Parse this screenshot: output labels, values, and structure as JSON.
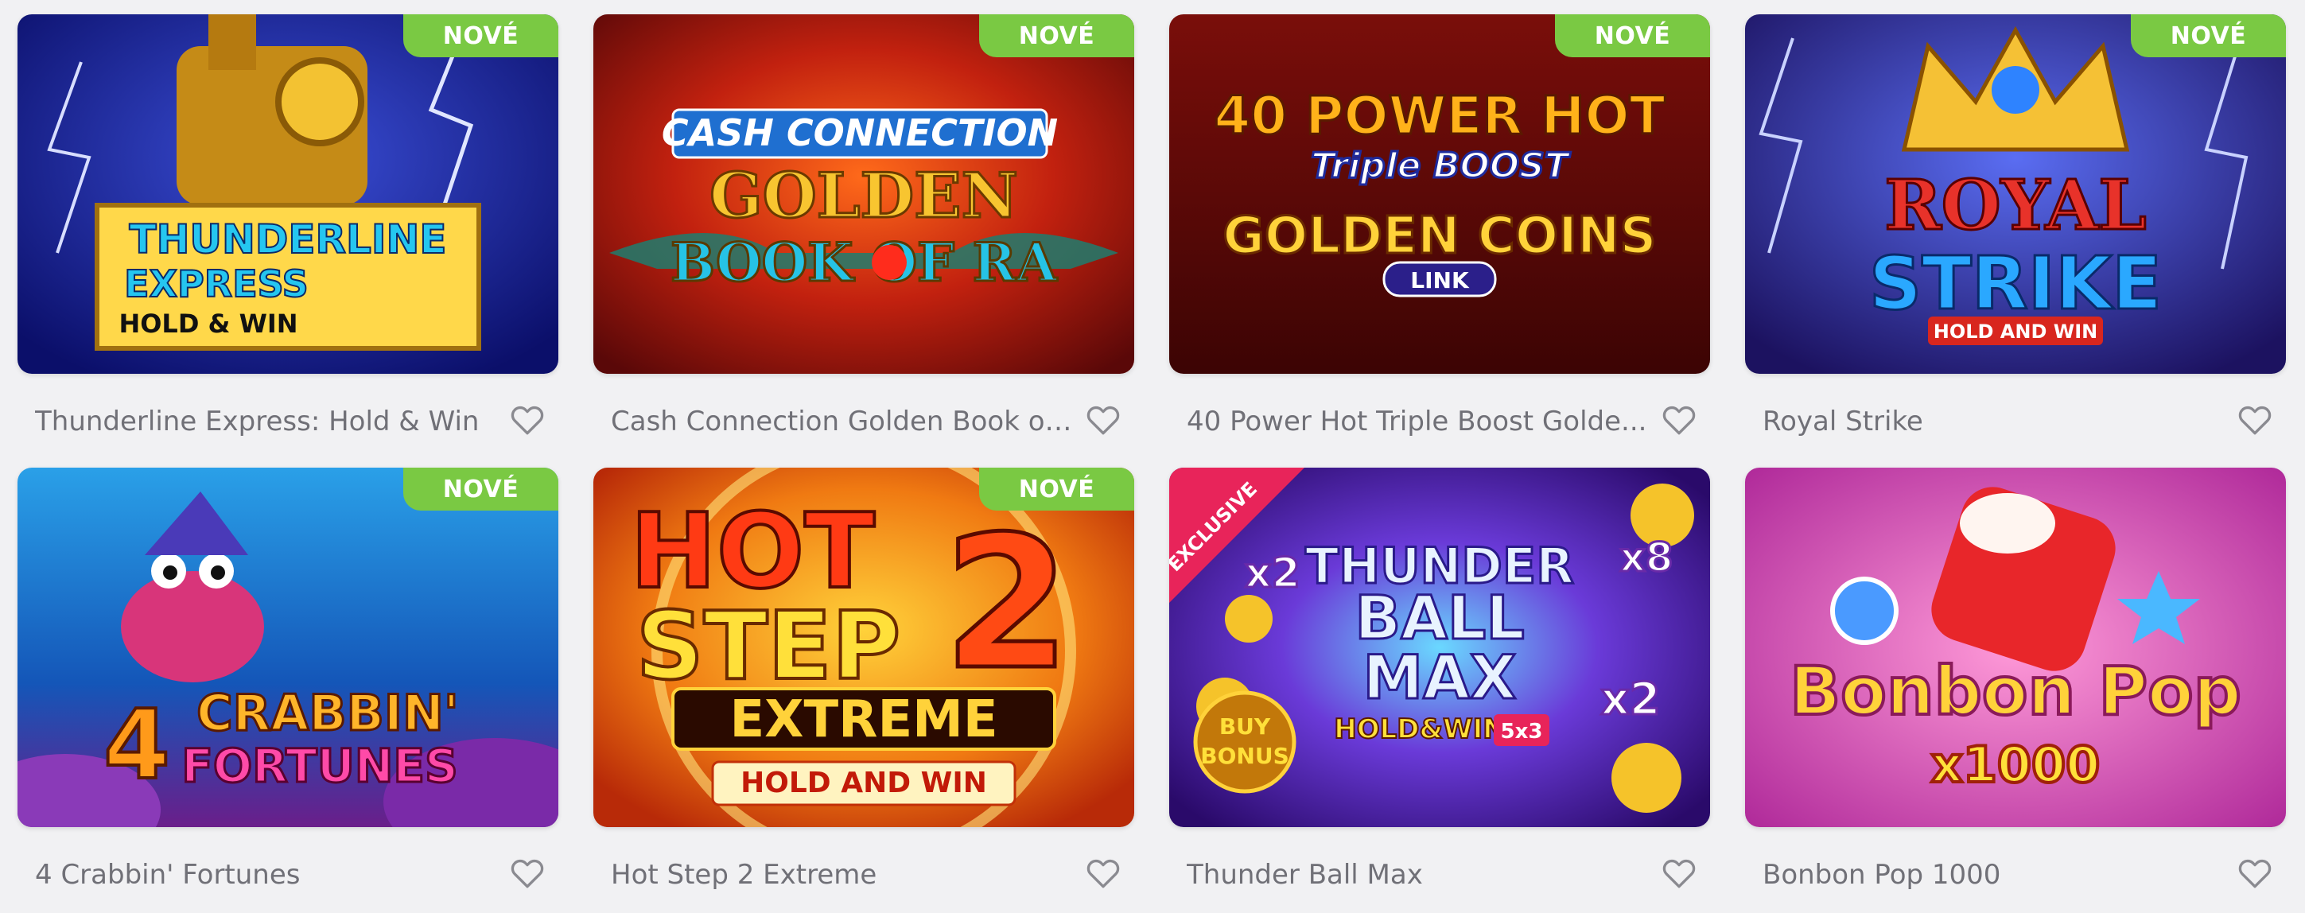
{
  "badge_label": "NOVÉ",
  "games": [
    {
      "title": "Thunderline Express: Hold & Win",
      "is_new": true,
      "art_text": [
        "THUNDERLINE",
        "EXPRESS",
        "HOLD & WIN"
      ]
    },
    {
      "title": "Cash Connection Golden Book of ...",
      "is_new": true,
      "art_text": [
        "CASH CONNECTION",
        "GOLDEN",
        "BOOK OF RA"
      ]
    },
    {
      "title": "40 Power Hot Triple Boost Golde...",
      "is_new": true,
      "art_text": [
        "40 POWER HOT",
        "Triple BOOST",
        "GOLDEN COINS",
        "LINK"
      ]
    },
    {
      "title": "Royal Strike",
      "is_new": true,
      "art_text": [
        "ROYAL",
        "STRIKE",
        "HOLD AND WIN"
      ]
    },
    {
      "title": "4 Crabbin' Fortunes",
      "is_new": true,
      "art_text": [
        "4",
        "CRABBIN'",
        "FORTUNES"
      ]
    },
    {
      "title": "Hot Step 2 Extreme",
      "is_new": true,
      "art_text": [
        "HOT",
        "STEP",
        "2",
        "EXTREME",
        "HOLD AND WIN"
      ]
    },
    {
      "title": "Thunder Ball Max",
      "is_new": false,
      "art_text": [
        "EXCLUSIVE",
        "x2",
        "x8",
        "THUNDER",
        "BALL",
        "MAX",
        "HOLD&WIN",
        "5x3",
        "BUY",
        "BONUS",
        "x2"
      ]
    },
    {
      "title": "Bonbon Pop 1000",
      "is_new": false,
      "art_text": [
        "Bonbon Pop",
        "x1000"
      ]
    }
  ],
  "colors": {
    "badge": "#7ac943",
    "title_text": "#707077",
    "heart": "#8a8a90"
  },
  "icons": {
    "favorite": "heart-outline-icon"
  }
}
